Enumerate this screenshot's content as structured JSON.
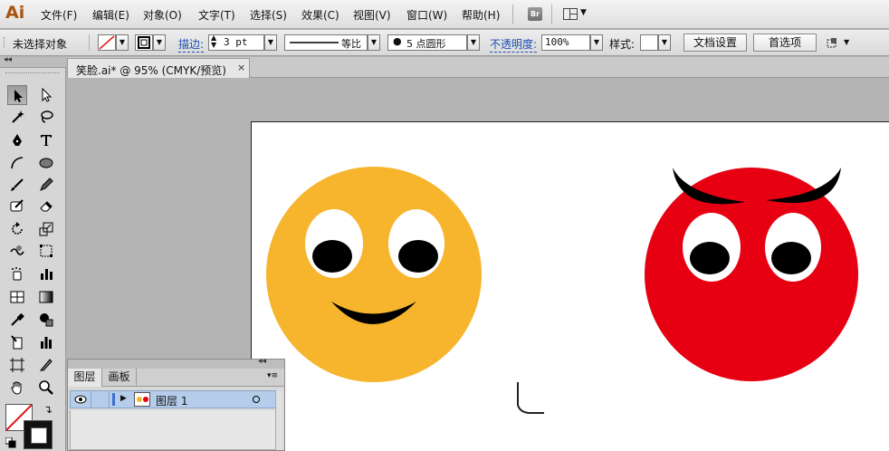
{
  "app": {
    "logo": "Ai"
  },
  "menu": [
    {
      "label": "文件(F)"
    },
    {
      "label": "编辑(E)"
    },
    {
      "label": "对象(O)"
    },
    {
      "label": "文字(T)"
    },
    {
      "label": "选择(S)"
    },
    {
      "label": "效果(C)"
    },
    {
      "label": "视图(V)"
    },
    {
      "label": "窗口(W)"
    },
    {
      "label": "帮助(H)"
    }
  ],
  "bridge_label": "Br",
  "control": {
    "selection_status": "未选择对象",
    "stroke_label": "描边:",
    "stroke_weight": "3 pt",
    "profile_label": "等比",
    "brush_label": "5 点圆形",
    "opacity_label": "不透明度:",
    "opacity_value": "100%",
    "style_label": "样式:",
    "doc_setup_button": "文档设置",
    "prefs_button": "首选项"
  },
  "document_tab": {
    "title": "笑脸.ai* @ 95% (CMYK/预览)",
    "close": "×"
  },
  "panel_collapse": "◂◂",
  "tools_collapse": "◂◂",
  "layers_panel": {
    "tabs": [
      {
        "label": "图层"
      },
      {
        "label": "画板"
      }
    ],
    "layer_name": "图层 1"
  },
  "colors": {
    "happy_face": "#f7b52e",
    "devil_face": "#e60012",
    "eye_white": "#ffffff",
    "pupil": "#000000",
    "layer_selected": "#b5cdea"
  },
  "icons": [
    "selection-icon",
    "direct-selection-icon",
    "magic-wand-icon",
    "lasso-icon",
    "pen-icon",
    "type-icon",
    "line-icon",
    "ellipse-icon",
    "paintbrush-icon",
    "pencil-icon",
    "blob-brush-icon",
    "eraser-icon",
    "rotate-icon",
    "scale-icon",
    "warp-icon",
    "free-transform-icon",
    "symbol-sprayer-icon",
    "column-graph-icon",
    "mesh-icon",
    "gradient-icon",
    "eyedropper-icon",
    "blend-icon",
    "slice-icon",
    "graph-icon",
    "artboard-icon",
    "knife-icon",
    "hand-icon",
    "zoom-icon"
  ]
}
